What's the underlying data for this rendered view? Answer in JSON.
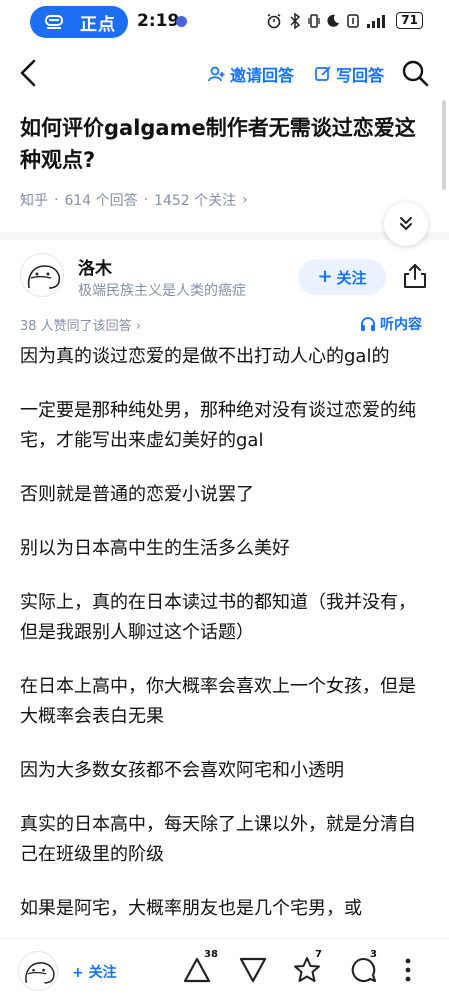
{
  "status_bar": {
    "pill_label": "正点",
    "time": "2:19",
    "battery": "71"
  },
  "nav": {
    "invite_label": "邀请回答",
    "write_label": "写回答"
  },
  "question": {
    "title": "如何评价galgame制作者无需谈过恋爱这种观点?",
    "source": "知乎",
    "answers": "614 个回答",
    "followers": "1452 个关注",
    "sep": "·",
    "chevron": "›"
  },
  "author": {
    "name": "洛木",
    "bio": "极端民族主义是人类的癌症",
    "follow_label": "关注",
    "likes_line": "38 人赞同了该回答 ›",
    "listen_label": "听内容"
  },
  "content": {
    "paragraphs": [
      "因为真的谈过恋爱的是做不出打动人心的gal的",
      "一定要是那种纯处男，那种绝对没有谈过恋爱的纯宅，才能写出来虚幻美好的gal",
      "否则就是普通的恋爱小说罢了",
      "别以为日本高中生的生活多么美好",
      "实际上，真的在日本读过书的都知道（我并没有，但是我跟别人聊过这个话题）",
      "在日本上高中，你大概率会喜欢上一个女孩，但是大概率会表白无果",
      "因为大多数女孩都不会喜欢阿宅和小透明",
      "真实的日本高中，每天除了上课以外，就是分清自己在班级里的阶级",
      "如果是阿宅，大概率朋友也是几个宅男，或"
    ]
  },
  "bottom_bar": {
    "follow_label": "+ 关注",
    "upvote_count": "38",
    "favorite_count": "7",
    "comment_count": "3"
  }
}
